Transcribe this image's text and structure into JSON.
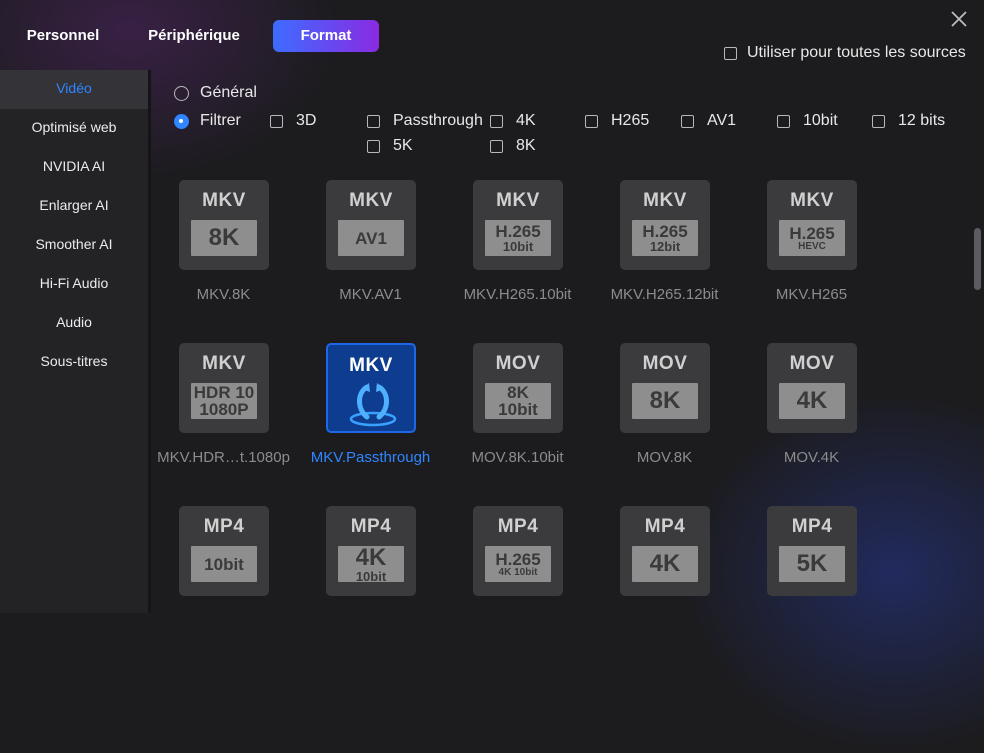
{
  "tabs": [
    {
      "label": "Personnel"
    },
    {
      "label": "Périphérique"
    },
    {
      "label": "Format",
      "active": true
    }
  ],
  "use_all_sources": {
    "label": "Utiliser pour toutes les sources",
    "checked": false
  },
  "sidebar": {
    "items": [
      {
        "label": "Vidéo",
        "active": true
      },
      {
        "label": "Optimisé web"
      },
      {
        "label": "NVIDIA AI"
      },
      {
        "label": "Enlarger AI"
      },
      {
        "label": "Smoother AI"
      },
      {
        "label": "Hi-Fi Audio"
      },
      {
        "label": "Audio"
      },
      {
        "label": "Sous-titres"
      }
    ]
  },
  "filters": {
    "general_label": "Général",
    "filter_label": "Filtrer",
    "selected": "Filtrer",
    "options": [
      "3D",
      "Passthrough",
      "4K",
      "H265",
      "AV1",
      "10bit",
      "12 bits",
      "5K",
      "8K"
    ]
  },
  "formats": [
    {
      "caption": "MKV.8K",
      "container": "MKV",
      "badge": [
        "8K"
      ],
      "badge_style": "big"
    },
    {
      "caption": "MKV.AV1",
      "container": "MKV",
      "badge": [
        "AV1"
      ],
      "badge_style": "mid"
    },
    {
      "caption": "MKV.H265.10bit",
      "container": "MKV",
      "badge": [
        "H.265",
        "10bit"
      ],
      "badge_style": "two"
    },
    {
      "caption": "MKV.H265.12bit",
      "container": "MKV",
      "badge": [
        "H.265",
        "12bit"
      ],
      "badge_style": "two"
    },
    {
      "caption": "MKV.H265",
      "container": "MKV",
      "badge": [
        "H.265",
        "HEVC"
      ],
      "badge_style": "two-xs"
    },
    {
      "caption": "MKV.HDR…t.1080p",
      "container": "MKV",
      "badge": [
        "HDR 10",
        "1080P"
      ],
      "badge_style": "two-even"
    },
    {
      "caption": "MKV.Passthrough",
      "container": "MKV",
      "badge": [],
      "badge_style": "passthrough",
      "selected": true
    },
    {
      "caption": "MOV.8K.10bit",
      "container": "MOV",
      "badge": [
        "8K",
        "10bit"
      ],
      "badge_style": "two-even"
    },
    {
      "caption": "MOV.8K",
      "container": "MOV",
      "badge": [
        "8K"
      ],
      "badge_style": "big"
    },
    {
      "caption": "MOV.4K",
      "container": "MOV",
      "badge": [
        "4K"
      ],
      "badge_style": "big"
    },
    {
      "caption": "",
      "container": "MP4",
      "badge": [
        "10bit"
      ],
      "badge_style": "mid"
    },
    {
      "caption": "",
      "container": "MP4",
      "badge": [
        "4K",
        "10bit"
      ],
      "badge_style": "two-big"
    },
    {
      "caption": "",
      "container": "MP4",
      "badge": [
        "H.265",
        "4K 10bit"
      ],
      "badge_style": "two-xs"
    },
    {
      "caption": "",
      "container": "MP4",
      "badge": [
        "4K"
      ],
      "badge_style": "big"
    },
    {
      "caption": "",
      "container": "MP4",
      "badge": [
        "5K"
      ],
      "badge_style": "big"
    }
  ],
  "colors": {
    "accent": "#2f86ff",
    "tab_gradient_start": "#3d6cff",
    "tab_gradient_end": "#8a2be2"
  }
}
